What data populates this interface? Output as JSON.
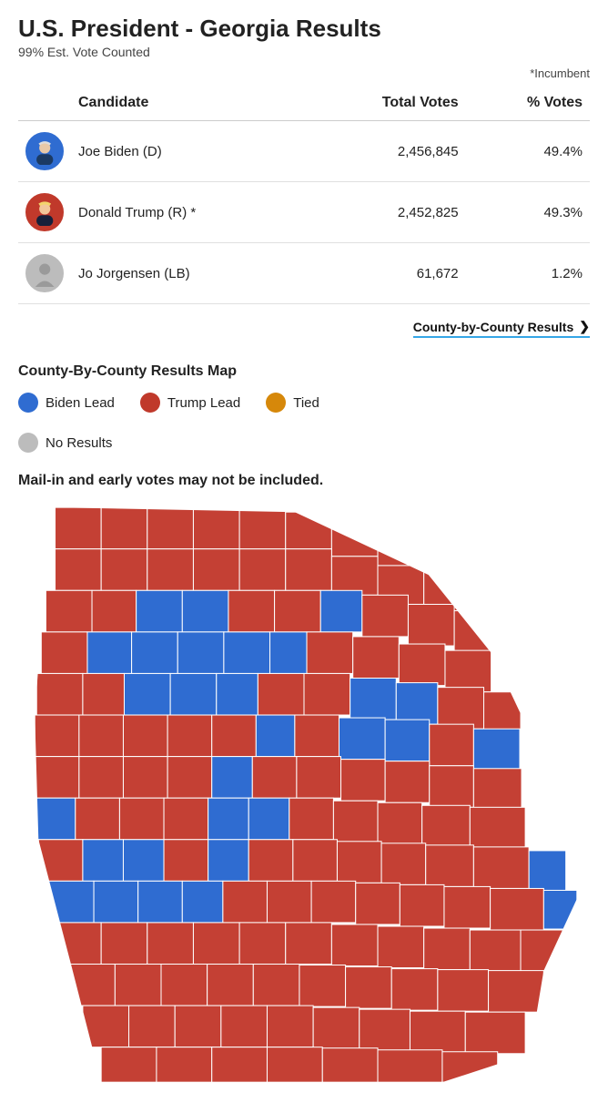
{
  "header": {
    "title": "U.S. President - Georgia Results",
    "subtitle": "99% Est. Vote Counted",
    "incumbent_note": "*Incumbent"
  },
  "table": {
    "cols": {
      "candidate": "Candidate",
      "total": "Total Votes",
      "pct": "% Votes"
    },
    "rows": [
      {
        "name": "Joe Biden (D)",
        "total": "2,456,845",
        "pct": "49.4%",
        "color": "blue"
      },
      {
        "name": "Donald Trump (R) *",
        "total": "2,452,825",
        "pct": "49.3%",
        "color": "red"
      },
      {
        "name": "Jo Jorgensen (LB)",
        "total": "61,672",
        "pct": "1.2%",
        "color": "gray"
      }
    ]
  },
  "county_link": "County-by-County Results",
  "map_section": {
    "heading": "County-By-County Results Map",
    "legend": {
      "biden": "Biden Lead",
      "trump": "Trump Lead",
      "tied": "Tied",
      "none": "No Results"
    },
    "warning": "Mail-in and early votes may not be included."
  },
  "colors": {
    "biden": "#2f6cd1",
    "trump": "#c0392b",
    "tied": "#d6880a",
    "none": "#bcbcbc"
  }
}
